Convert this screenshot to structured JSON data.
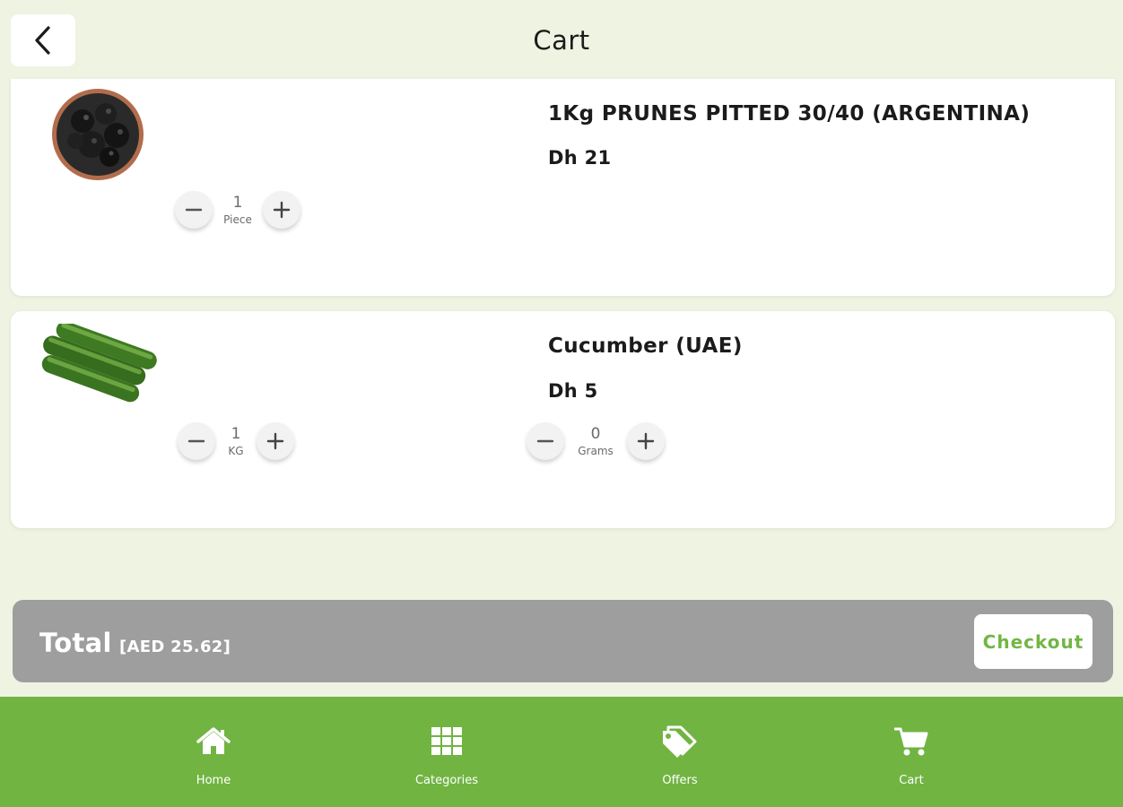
{
  "header": {
    "title": "Cart",
    "back_icon": "chevron-left-icon"
  },
  "cart": {
    "items": [
      {
        "name": "1Kg PRUNES PITTED 30/40 (ARGENTINA)",
        "price": "Dh 21",
        "image": "prunes-bowl",
        "steppers": [
          {
            "value": "1",
            "unit": "Piece"
          }
        ]
      },
      {
        "name": "Cucumber (UAE)",
        "price": "Dh 5",
        "image": "cucumbers",
        "steppers": [
          {
            "value": "1",
            "unit": "KG"
          },
          {
            "value": "0",
            "unit": "Grams"
          }
        ]
      }
    ]
  },
  "summary": {
    "total_label": "Total",
    "total_amount": "[AED 25.62]",
    "checkout_label": "Checkout"
  },
  "nav": {
    "items": [
      {
        "label": "Home",
        "icon": "home-icon"
      },
      {
        "label": "Categories",
        "icon": "grid-icon"
      },
      {
        "label": "Offers",
        "icon": "tags-icon"
      },
      {
        "label": "Cart",
        "icon": "cart-icon"
      }
    ]
  },
  "colors": {
    "background": "#eef3e2",
    "accent_green": "#71b442",
    "total_bar": "#9e9e9e",
    "card": "#ffffff"
  }
}
